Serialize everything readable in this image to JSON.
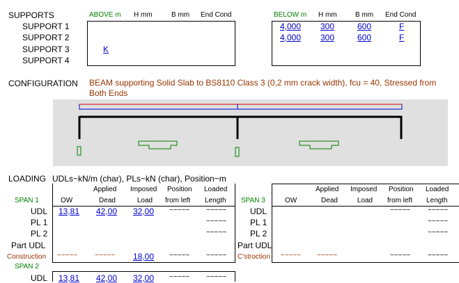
{
  "supports": {
    "title": "SUPPORTS",
    "rows": [
      "SUPPORT 1",
      "SUPPORT 2",
      "SUPPORT 3",
      "SUPPORT 4"
    ],
    "above_header": "ABOVE m",
    "below_header": "BELOW m",
    "h_header": "H mm",
    "b_header": "B mm",
    "end_header": "End Cond",
    "above_values": {
      "s3_end": "K"
    },
    "below_values": [
      {
        "below": "4,000",
        "h": "300",
        "b": "600",
        "end": "F"
      },
      {
        "below": "4,000",
        "h": "300",
        "b": "600",
        "end": "F"
      }
    ]
  },
  "configuration": {
    "label": "CONFIGURATION",
    "description_line1": "BEAM supporting Solid Slab to BS8110 Class 3 (0,2 mm crack width), fcu = 40, Stressed from",
    "description_line2": "Both Ends"
  },
  "loading": {
    "label": "LOADING",
    "units": "UDLs~kN/m (char),  PLs~kN (char),  Position~m",
    "headers": {
      "applied_1": "Applied",
      "applied_2": "Dead",
      "imposed_1": "Imposed",
      "imposed_2": "Load",
      "position_1": "Position",
      "position_2": "from left",
      "loaded_1": "Loaded",
      "loaded_2": "Length",
      "ow": "OW"
    },
    "span1": {
      "title": "SPAN 1",
      "udl_label": "UDL",
      "udl_ow": "13,81",
      "udl_dead": "42,00",
      "udl_imposed": "32,00",
      "udl_pos": "~~~~~",
      "udl_len": "~~~~~",
      "pl1_label": "PL 1",
      "pl1_len": "~~~~~",
      "pl2_label": "PL 2",
      "pl2_len": "~~~~~",
      "part_label": "Part UDL",
      "const_label": "Construction",
      "const_ow": "~~~~~",
      "const_dead": "~~~~~",
      "const_imposed": "18,00",
      "const_pos": "~~~~~",
      "const_len": "~~~~~"
    },
    "span3": {
      "title": "SPAN 3",
      "udl_label": "UDL",
      "udl_pos": "~~~~~",
      "udl_len": "~~~~~",
      "pl1_label": "PL 1",
      "pl1_len": "~~~~~",
      "pl2_label": "PL 2",
      "pl2_len": "~~~~~",
      "part_label": "Part UDL",
      "const_label": "C'stroction",
      "const_ow": "~~~~~",
      "const_dead": "~~~~~",
      "const_pos": "~~~~~",
      "const_len": "~~~~~"
    },
    "span2": {
      "title": "SPAN 2",
      "udl_label": "UDL",
      "udl_ow": "13,81",
      "udl_dead": "42,00",
      "udl_imposed": "32,00",
      "udl_pos": "~~~~~",
      "udl_len": "~~~~~"
    }
  }
}
